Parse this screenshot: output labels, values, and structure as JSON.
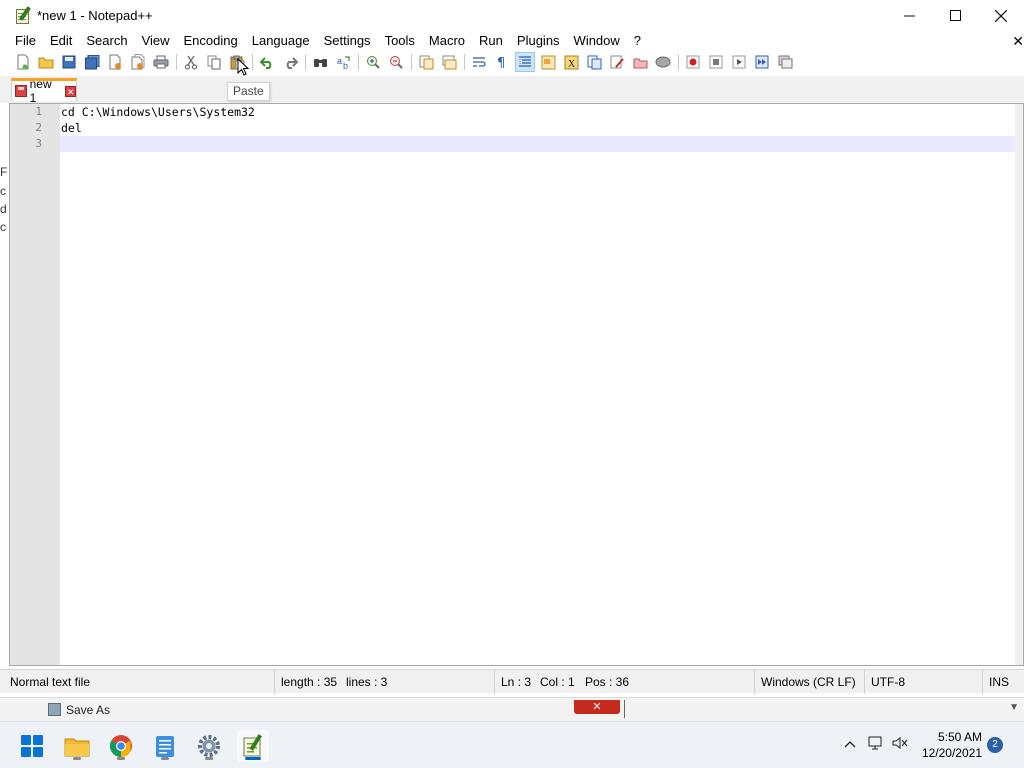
{
  "window": {
    "title": "*new 1 - Notepad++",
    "minimize": "—",
    "maximize": "☐",
    "close": "✕"
  },
  "menu": {
    "items": [
      "File",
      "Edit",
      "Search",
      "View",
      "Encoding",
      "Language",
      "Settings",
      "Tools",
      "Macro",
      "Run",
      "Plugins",
      "Window",
      "?"
    ],
    "close_doc": "✕"
  },
  "toolbar": {
    "tooltip": "Paste",
    "icons": [
      "new-file-icon",
      "open-file-icon",
      "save-icon",
      "save-all-icon",
      "close-icon",
      "close-all-icon",
      "print-icon",
      "cut-icon",
      "copy-icon",
      "paste-icon",
      "undo-icon",
      "redo-icon",
      "find-icon",
      "replace-icon",
      "zoom-in-icon",
      "zoom-out-icon",
      "sync-vertical-icon",
      "sync-horizontal-icon",
      "word-wrap-icon",
      "show-all-chars-icon",
      "indent-guide-icon",
      "udl-icon",
      "doc-map-icon",
      "function-list-icon",
      "folder-workspace-icon",
      "doc-switcher-icon",
      "monitoring-icon",
      "record-macro-icon",
      "stop-macro-icon",
      "play-macro-icon",
      "run-macro-multiple-icon",
      "save-macro-icon"
    ]
  },
  "tab": {
    "label": "new 1",
    "close": "✕"
  },
  "editor": {
    "line_numbers": [
      "1",
      "2",
      "3"
    ],
    "lines": [
      "cd C:\\Windows\\Users\\System32",
      "del",
      ""
    ],
    "current_line": 3
  },
  "behind": {
    "chars": [
      "F",
      "c",
      "d",
      "c"
    ]
  },
  "status": {
    "file_type": "Normal text file",
    "length": "length : 35",
    "lines": "lines : 3",
    "ln": "Ln : 3",
    "col": "Col : 1",
    "pos": "Pos : 36",
    "eol": "Windows (CR LF)",
    "encoding": "UTF-8",
    "mode": "INS"
  },
  "background_window": {
    "title": "Save As",
    "close": "✕"
  },
  "taskbar": {
    "apps": [
      "start-icon",
      "file-explorer-icon",
      "chrome-icon",
      "notepad-icon",
      "settings-icon",
      "notepadpp-icon"
    ],
    "time": "5:50 AM",
    "date": "12/20/2021",
    "notification_count": "2",
    "chevron": "^"
  }
}
